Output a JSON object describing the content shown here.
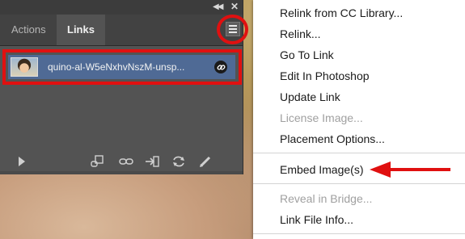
{
  "panel": {
    "tabs": [
      {
        "label": "Actions",
        "active": false
      },
      {
        "label": "Links",
        "active": true
      }
    ],
    "links": [
      {
        "name": "quino-al-W5eNxhvNszM-unsp..."
      }
    ],
    "bottom_toolbar_icons": [
      "play-icon",
      "relink-from-cc-icon",
      "go-to-link-icon",
      "embed-icon",
      "update-link-icon",
      "edit-original-icon"
    ]
  },
  "menu": {
    "items": [
      {
        "label": "Relink from CC Library...",
        "enabled": true
      },
      {
        "label": "Relink...",
        "enabled": true
      },
      {
        "label": "Go To Link",
        "enabled": true
      },
      {
        "label": "Edit In Photoshop",
        "enabled": true
      },
      {
        "label": "Update Link",
        "enabled": true
      },
      {
        "label": "License Image...",
        "enabled": false
      },
      {
        "label": "Placement Options...",
        "enabled": true
      },
      {
        "label": "Embed Image(s)",
        "enabled": true
      },
      {
        "label": "Reveal in Bridge...",
        "enabled": false
      },
      {
        "label": "Link File Info...",
        "enabled": true
      }
    ]
  },
  "colors": {
    "highlight": "#e01010",
    "selected_row": "#4f6a95",
    "panel_bg": "#535353"
  }
}
